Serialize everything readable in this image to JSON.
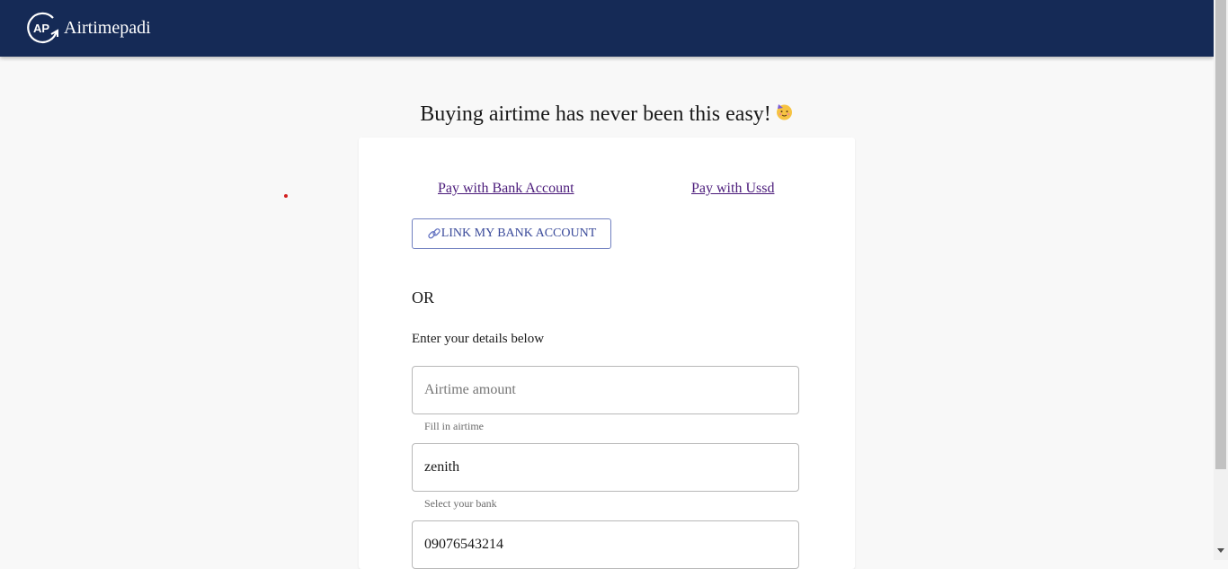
{
  "header": {
    "logo_mark_text": "AP",
    "brand_name": "Airtimepadi",
    "background_color": "#152a56"
  },
  "main": {
    "headline": "Buying airtime has never been this easy!",
    "headline_emoji": "party-face-icon"
  },
  "card": {
    "tabs": [
      {
        "label": "Pay with Bank Account"
      },
      {
        "label": "Pay with Ussd"
      }
    ],
    "link_bank_button": {
      "icon": "link-icon",
      "label": "LINK MY BANK ACCOUNT"
    },
    "or_text": "OR",
    "details_label": "Enter your details below",
    "fields": {
      "airtime_amount": {
        "value": "",
        "placeholder": "Airtime amount",
        "helper": "Fill in airtime"
      },
      "bank": {
        "value": "zenith",
        "placeholder": "",
        "helper": "Select your bank"
      },
      "phone": {
        "value": "09076543214",
        "placeholder": ""
      }
    }
  },
  "colors": {
    "page_background": "#f8f8f8",
    "link_color": "#4a1a7a",
    "button_border": "#7080c0"
  }
}
